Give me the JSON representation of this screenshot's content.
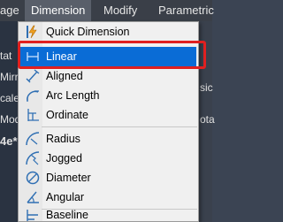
{
  "menubar": {
    "items": [
      {
        "label": "age"
      },
      {
        "label": "Dimension"
      },
      {
        "label": "Modify"
      },
      {
        "label": "Parametric"
      }
    ]
  },
  "background": {
    "left_fragments": [
      "tat",
      "Mirro",
      "cale",
      "Modif"
    ],
    "doc_tab": "4e*",
    "right_fragments": [
      "sic",
      "ota"
    ]
  },
  "dropdown": {
    "items": [
      {
        "label": "Quick Dimension",
        "mnemonic": "Q",
        "icon": "quick-dimension-icon"
      },
      {
        "label": "Linear",
        "mnemonic": "L",
        "icon": "linear-dimension-icon",
        "selected": true
      },
      {
        "label": "Aligned",
        "mnemonic": "G",
        "icon": "aligned-dimension-icon"
      },
      {
        "label": "Arc Length",
        "mnemonic": "H",
        "icon": "arc-length-icon"
      },
      {
        "label": "Ordinate",
        "mnemonic": "O",
        "icon": "ordinate-icon"
      },
      {
        "label": "Radius",
        "mnemonic": "R",
        "icon": "radius-icon"
      },
      {
        "label": "Jogged",
        "mnemonic": "J",
        "icon": "jogged-icon"
      },
      {
        "label": "Diameter",
        "mnemonic": "D",
        "icon": "diameter-icon"
      },
      {
        "label": "Angular",
        "mnemonic": "A",
        "icon": "angular-icon"
      },
      {
        "label": "Baseline",
        "mnemonic": "B",
        "icon": "baseline-icon"
      }
    ]
  },
  "colors": {
    "selection": "#0a6cd6",
    "highlight_frame": "#e02020",
    "menubar_bg": "#3a3f48",
    "menu_bg": "#f0f0f0"
  }
}
